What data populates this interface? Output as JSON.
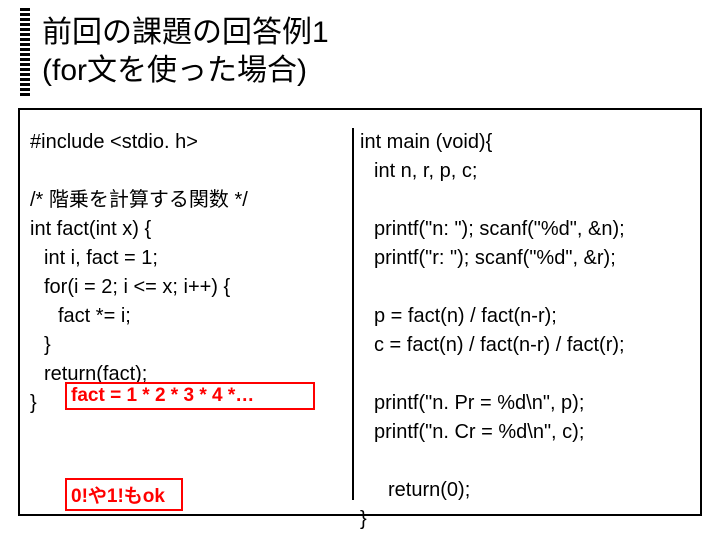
{
  "title_line1": "前回の課題の回答例1",
  "title_line2": "(for文を使った場合)",
  "left": {
    "l1": "#include <stdio. h>",
    "l2": "/* 階乗を計算する関数 */",
    "l3": "int fact(int x) {",
    "l4": "int i, fact = 1;",
    "l5": "for(i = 2; i <= x; i++) {",
    "l6": "fact *= i;",
    "l7": "}",
    "l8": "return(fact);",
    "l9": "}"
  },
  "right": {
    "l1": "int main (void){",
    "l2": "int n, r, p, c;",
    "l3": "printf(\"n: \"); scanf(\"%d\", &n);",
    "l4": "printf(\"r: \"); scanf(\"%d\", &r);",
    "l5": "p = fact(n) / fact(n-r);",
    "l6": "c = fact(n) / fact(n-r) / fact(r);",
    "l7": "printf(\"n. Pr = %d\\n\", p);",
    "l8": "printf(\"n. Cr = %d\\n\", c);",
    "l9": "return(0);",
    "l10": "}"
  },
  "callout1": "fact = 1  * 2  * 3  * 4  *…",
  "callout2": "0!や1!もok"
}
